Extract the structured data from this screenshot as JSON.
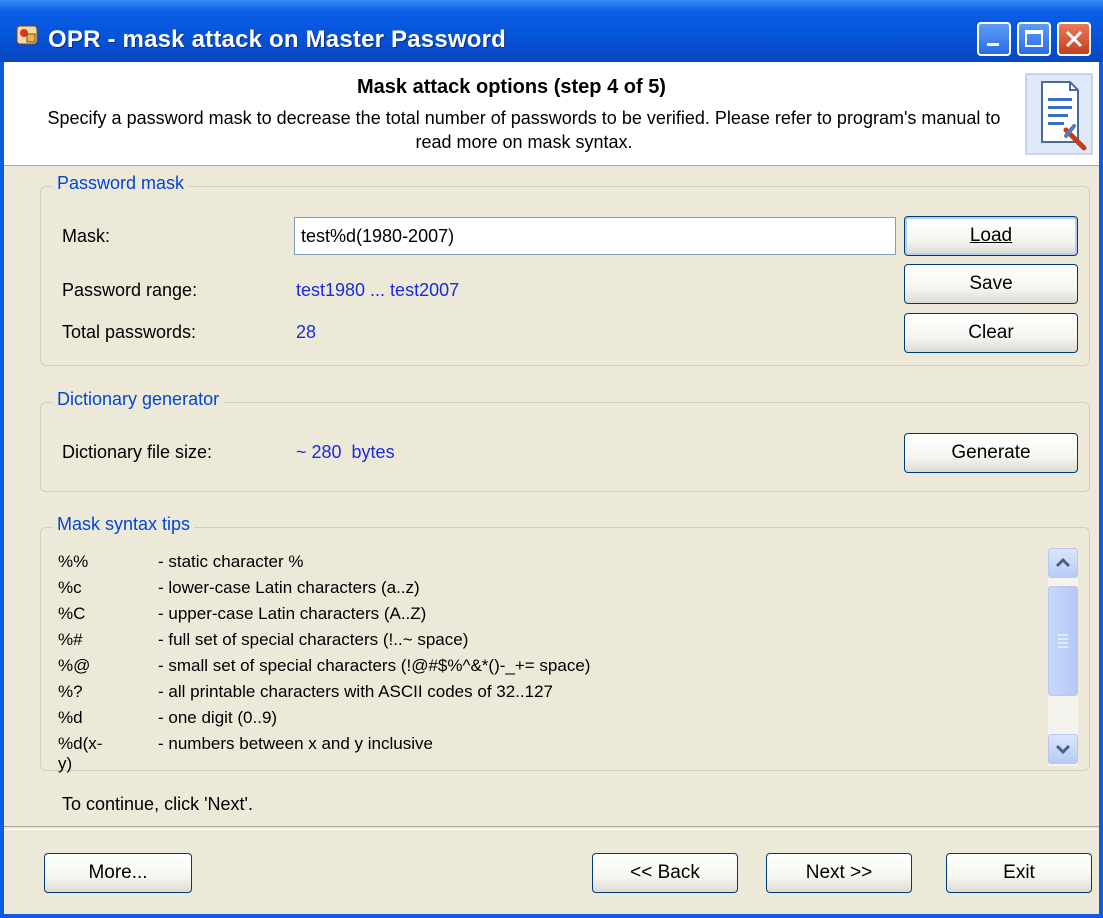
{
  "window": {
    "title": "OPR - mask attack on Master Password"
  },
  "header": {
    "title": "Mask attack options (step 4 of 5)",
    "description": "Specify a password mask to decrease the total number of passwords to be verified. Please refer to program's manual to read more on mask syntax."
  },
  "password_mask": {
    "legend": "Password mask",
    "mask_label": "Mask:",
    "mask_value": "test%d(1980-2007)",
    "range_label": "Password range:",
    "range_value": "test1980 ... test2007",
    "total_label": "Total passwords:",
    "total_value": "28",
    "load_label": "Load",
    "save_label": "Save",
    "clear_label": "Clear"
  },
  "dictionary": {
    "legend": "Dictionary generator",
    "size_label": "Dictionary file size:",
    "size_value": "~ 280  bytes",
    "generate_label": "Generate"
  },
  "tips": {
    "legend": "Mask syntax tips",
    "rows": [
      {
        "code": "%%",
        "desc": "- static character %"
      },
      {
        "code": "%c",
        "desc": "- lower-case Latin characters  (a..z)"
      },
      {
        "code": "%C",
        "desc": "- upper-case Latin characters (A..Z)"
      },
      {
        "code": "%#",
        "desc": "- full set of special characters (!..~ space)"
      },
      {
        "code": "%@",
        "desc": "- small set of special characters (!@#$%^&*()-_+= space)"
      },
      {
        "code": "%?",
        "desc": "- all printable characters with ASCII codes of 32..127"
      },
      {
        "code": "%d",
        "desc": "- one digit (0..9)"
      },
      {
        "code": "%d(x-y)",
        "desc": "- numbers between x and y inclusive"
      }
    ]
  },
  "footer": {
    "continue_text": "To continue, click 'Next'.",
    "more_label": "More...",
    "back_label": "<< Back",
    "next_label": "Next >>",
    "exit_label": "Exit"
  }
}
